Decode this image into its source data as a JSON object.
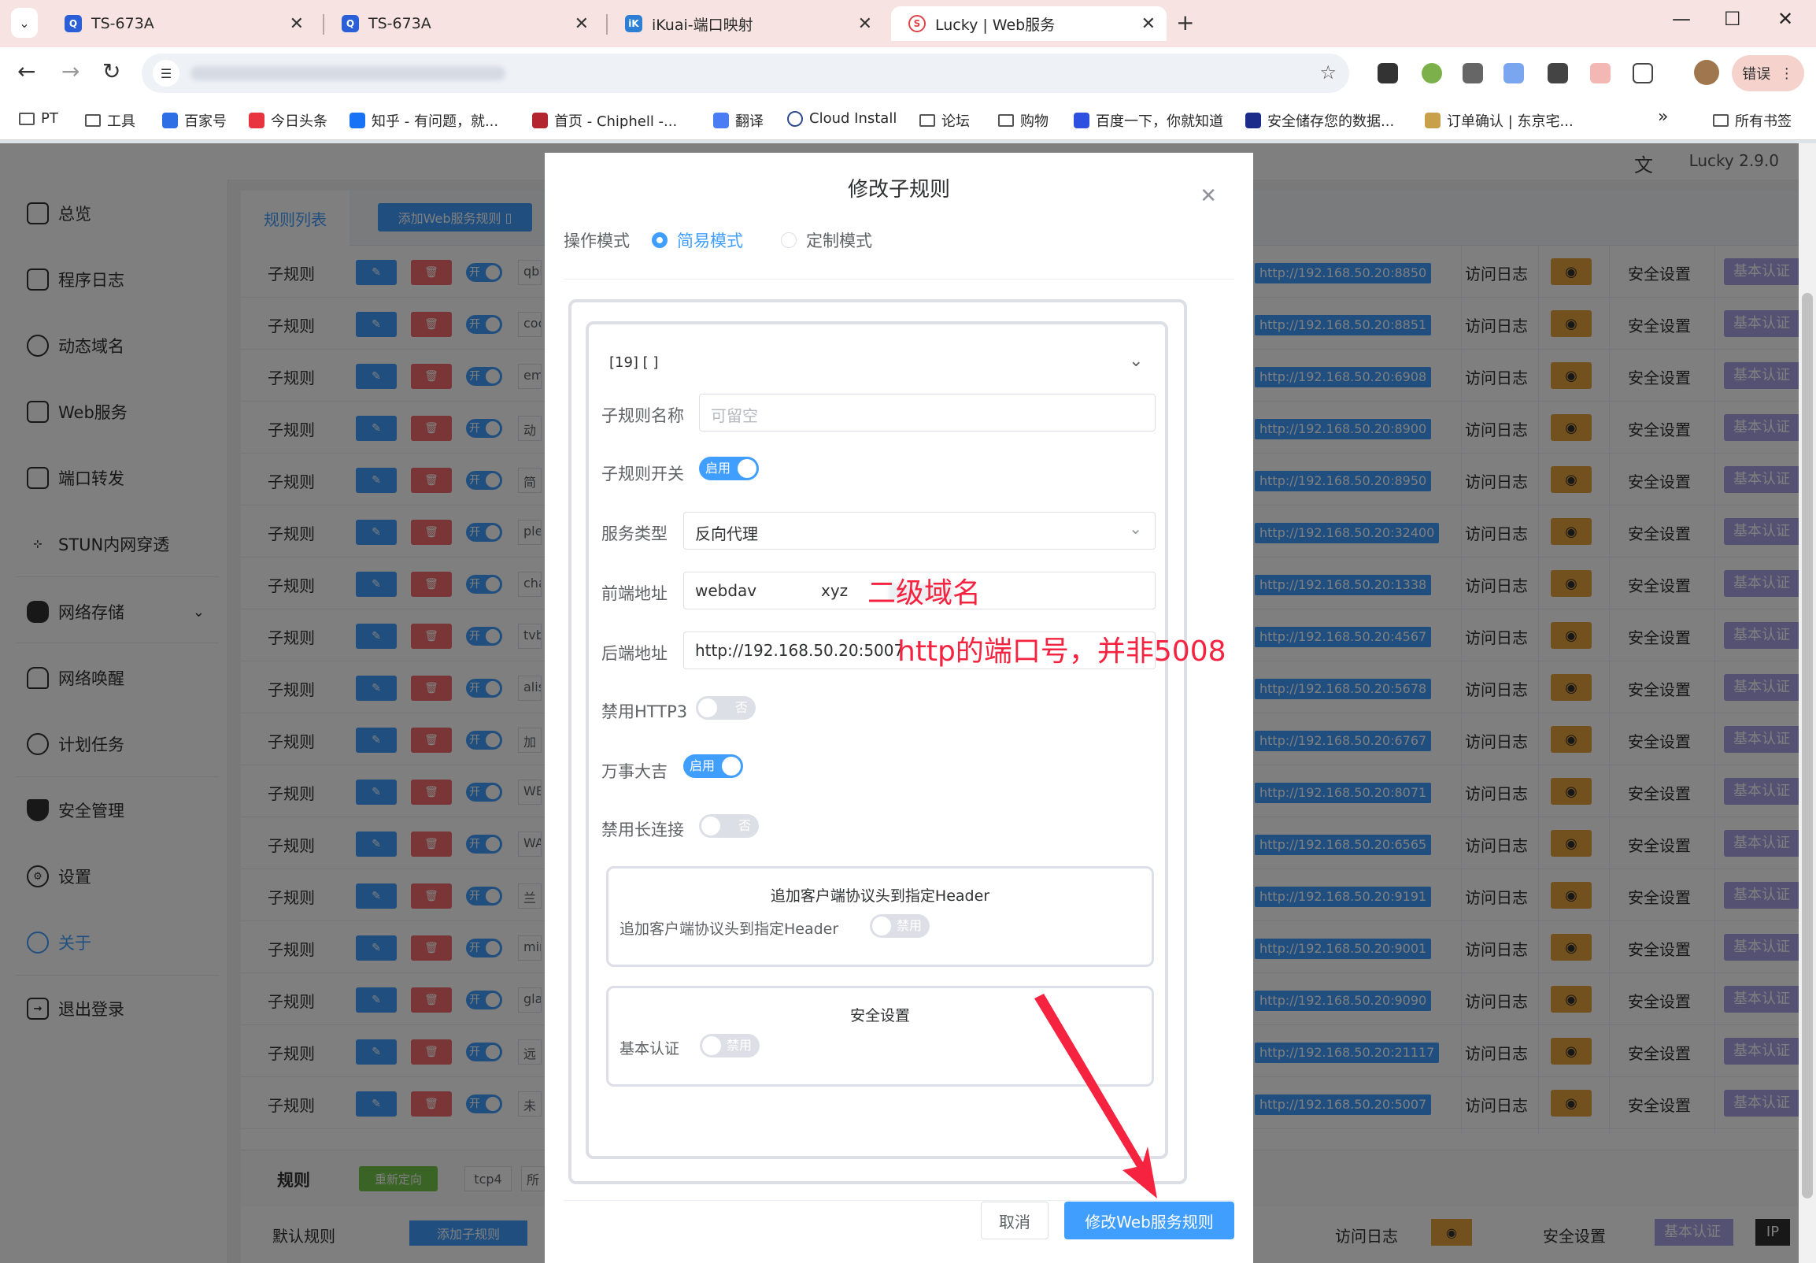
{
  "browser": {
    "tabs": [
      {
        "title": "TS-673A",
        "active": false
      },
      {
        "title": "TS-673A",
        "active": false
      },
      {
        "title": "iKuai-端口映射",
        "active": false
      },
      {
        "title": "Lucky | Web服务",
        "active": true
      }
    ],
    "new_tab": "+",
    "error_badge": "错误",
    "bookmarks": [
      "PT",
      "工具",
      "百家号",
      "今日头条",
      "知乎 - 有问题，就...",
      "首页 - Chiphell -...",
      "翻译",
      "Cloud Install",
      "论坛",
      "购物",
      "百度一下，你就知道",
      "安全储存您的数据...",
      "订单确认 | 东京宅...",
      "»",
      "所有书签"
    ]
  },
  "app": {
    "version": "Lucky 2.9.0",
    "sidebar": [
      {
        "label": "总览",
        "icon": "dashboard-icon"
      },
      {
        "label": "程序日志",
        "icon": "log-icon"
      },
      {
        "label": "动态域名",
        "icon": "ddns-icon"
      },
      {
        "label": "Web服务",
        "icon": "web-icon"
      },
      {
        "label": "端口转发",
        "icon": "port-forward-icon"
      },
      {
        "label": "STUN内网穿透",
        "icon": "stun-icon"
      },
      {
        "label": "网络存储",
        "icon": "cloud-storage-icon"
      },
      {
        "label": "网络唤醒",
        "icon": "bell-icon"
      },
      {
        "label": "计划任务",
        "icon": "clock-icon"
      },
      {
        "label": "安全管理",
        "icon": "shield-icon"
      },
      {
        "label": "设置",
        "icon": "gear-icon"
      },
      {
        "label": "关于",
        "icon": "about-icon"
      },
      {
        "label": "退出登录",
        "icon": "logout-icon"
      }
    ],
    "tab_rule_list": "规则列表",
    "add_web_rule": "添加Web服务规则",
    "rows": [
      {
        "label": "子规则",
        "switch": "开",
        "name": "qbi",
        "url": "http://192.168.50.20:8850"
      },
      {
        "label": "子规则",
        "switch": "开",
        "name": "coc",
        "url": "http://192.168.50.20:8851"
      },
      {
        "label": "子规则",
        "switch": "开",
        "name": "em",
        "url": "http://192.168.50.20:6908"
      },
      {
        "label": "子规则",
        "switch": "开",
        "name": "动漫",
        "url": "http://192.168.50.20:8900"
      },
      {
        "label": "子规则",
        "switch": "开",
        "name": "简单",
        "url": "http://192.168.50.20:8950"
      },
      {
        "label": "子规则",
        "switch": "开",
        "name": "ple",
        "url": "http://192.168.50.20:32400"
      },
      {
        "label": "子规则",
        "switch": "开",
        "name": "cha",
        "url": "http://192.168.50.20:1338"
      },
      {
        "label": "子规则",
        "switch": "开",
        "name": "tvb",
        "url": "http://192.168.50.20:4567"
      },
      {
        "label": "子规则",
        "switch": "开",
        "name": "alis",
        "url": "http://192.168.50.20:5678"
      },
      {
        "label": "子规则",
        "switch": "开",
        "name": "加密",
        "url": "http://192.168.50.20:6767"
      },
      {
        "label": "子规则",
        "switch": "开",
        "name": "WE",
        "url": "http://192.168.50.20:8071"
      },
      {
        "label": "子规则",
        "switch": "开",
        "name": "WA",
        "url": "http://192.168.50.20:6565"
      },
      {
        "label": "子规则",
        "switch": "开",
        "name": "兰空",
        "url": "http://192.168.50.20:9191"
      },
      {
        "label": "子规则",
        "switch": "开",
        "name": "mir",
        "url": "http://192.168.50.20:9001"
      },
      {
        "label": "子规则",
        "switch": "开",
        "name": "gla",
        "url": "http://192.168.50.20:9090"
      },
      {
        "label": "子规则",
        "switch": "开",
        "name": "远程",
        "url": "http://192.168.50.20:21117"
      },
      {
        "label": "子规则",
        "switch": "开",
        "name": "未命",
        "url": "http://192.168.50.20:5007"
      }
    ],
    "row_log": "访问日志",
    "row_security": "安全设置",
    "row_auth": "基本认证",
    "bottom_rule_label": "规则",
    "bottom_redirect": "重新定向",
    "bottom_tcp4": "tcp4",
    "bottom_all": "所",
    "default_rule": "默认规则",
    "add_subrule": "添加子规则",
    "bottom_log": "访问日志",
    "bottom_security": "安全设置",
    "bottom_auth": "基本认证",
    "bottom_ip": "IP"
  },
  "modal": {
    "title": "修改子规则",
    "op_mode_label": "操作模式",
    "mode_simple": "简易模式",
    "mode_custom": "定制模式",
    "collapse_title": "[19] [ ]",
    "name_label": "子规则名称",
    "name_placeholder": "可留空",
    "switch_label": "子规则开关",
    "switch_value": "启用",
    "service_label": "服务类型",
    "service_value": "反向代理",
    "frontend_label": "前端地址",
    "frontend_prefix": "webdav",
    "frontend_suffix": "xyz",
    "frontend_annot": "二级域名",
    "backend_label": "后端地址",
    "backend_value": "http://192.168.50.20:5007",
    "backend_annot": "http的端口号，并非5008",
    "http3_label": "禁用HTTP3",
    "http3_value": "否",
    "luck_label": "万事大吉",
    "luck_value": "启用",
    "keepalive_label": "禁用长连接",
    "keepalive_value": "否",
    "header_box_title": "追加客户端协议头到指定Header",
    "header_box_label": "追加客户端协议头到指定Header",
    "header_box_value": "禁用",
    "security_box_title": "安全设置",
    "security_box_label": "基本认证",
    "security_box_value": "禁用",
    "cancel": "取消",
    "submit": "修改Web服务规则",
    "arrow_color": "#f5233f"
  }
}
